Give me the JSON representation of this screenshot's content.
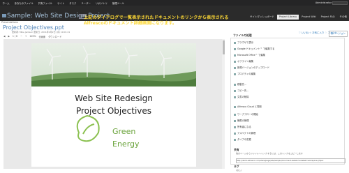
{
  "topbar": {
    "items": [
      "ホーム",
      "あなたのファイル",
      "共有ファイル",
      "サイト",
      "タスク",
      "ユーザー",
      "リポジトリ",
      "管理ツール"
    ],
    "admin": "Administrator"
  },
  "header": {
    "site_title": "Sample: Web Site Design Project",
    "badge": "公開",
    "nav": [
      "サイトダッシュボード",
      "Project Library",
      "Project Wiki",
      "Project FAQ",
      "その他"
    ]
  },
  "banner": {
    "line1": "上記のダイアログで一覧表示されたドキュメントのリンクから表示される",
    "line2": "Alfrescoのドキュメント詳細画面になります。"
  },
  "breadcrumb": "Presentations",
  "doc": {
    "title": "Project Objectives.ppt",
    "badge": "1.0",
    "meta": "更新者: Mike Jackson   更新日: 2011年2月2日 (水) 19:01:21",
    "actions": "♡ いいね   ☆ お気に入り   ♢ コメント"
  },
  "toolbar": [
    "◀",
    "▶",
    "1 / 6",
    "−",
    "+",
    "120%",
    "全画面",
    "ダウンロード"
  ],
  "slide": {
    "title1": "Web Site Redesign",
    "title2": "Project Objectives",
    "logo1": "Green",
    "logo2": "Energy"
  },
  "colors": {
    "accent": "#4a7fb5",
    "logo": "#6aa33b",
    "banner": "#fdd835",
    "dark": "#252526"
  },
  "panel": {
    "upload": "新バージョン",
    "title": "ファイルの処理",
    "actions": [
      "ブラウザで表示",
      "Google ドキュメント™ で編集する",
      "Microsoft Office™ で編集",
      "オフライン編集",
      "新規バージョンのアップロード",
      "プロパティの編集",
      "移動先...",
      "コピー先...",
      "文書の削除",
      "Alfresco Cloud と同期",
      "ワークフローの開始",
      "権限の管理",
      "所有者になる",
      "アスペクトの管理",
      "タイプの変更"
    ],
    "tags_title": "タグ",
    "tags_value": "(なし)",
    "share_title": "共有",
    "share_note": "他のページからファイルへリンクするには、このリンクをコピーします",
    "share_url": "http://demo.alfresco.com/share/page/site/sample/document-details?nodeRef=workspace://Spac"
  }
}
